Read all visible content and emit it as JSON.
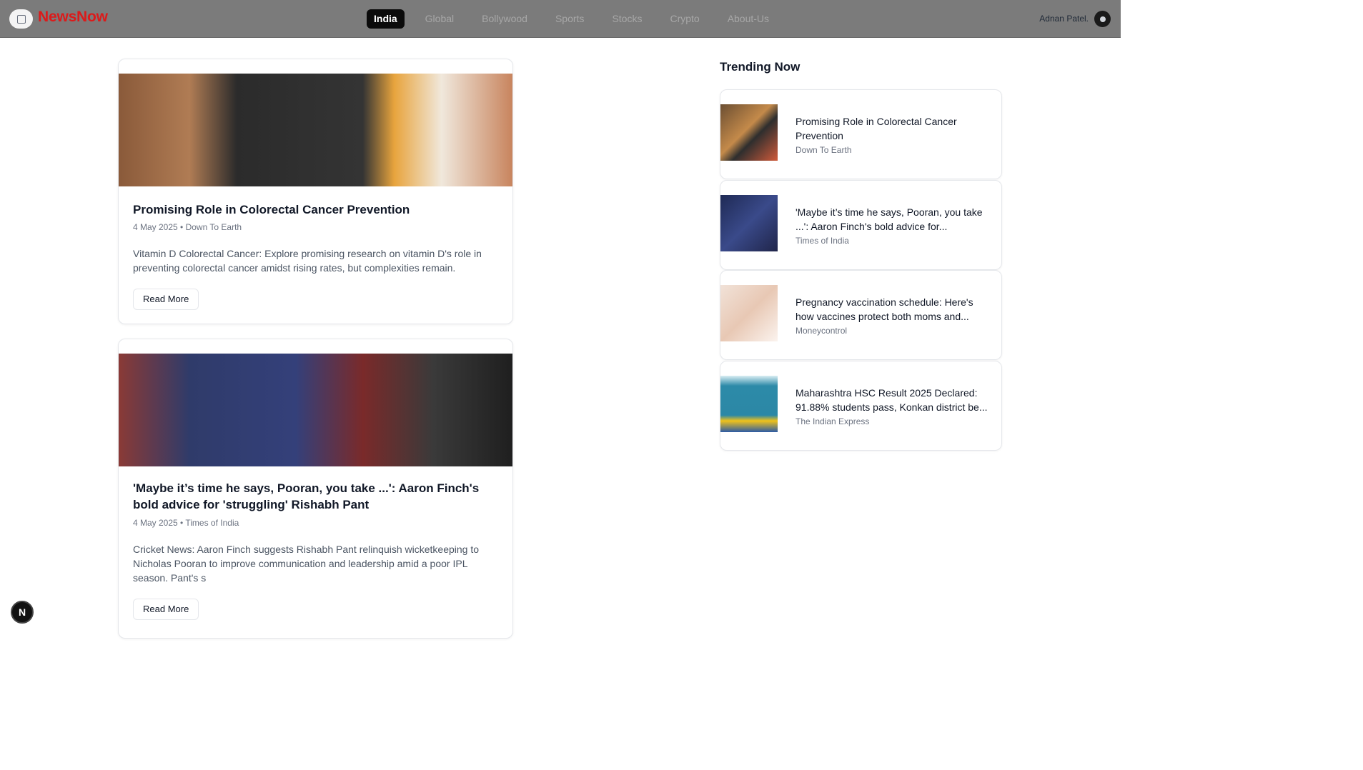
{
  "header": {
    "brand": "NewsNow",
    "nav": [
      "India",
      "Global",
      "Bollywood",
      "Sports",
      "Stocks",
      "Crypto",
      "About-Us"
    ],
    "active_nav": "India",
    "user_name": "Adnan Patel."
  },
  "articles": [
    {
      "title": "Promising Role in Colorectal Cancer Prevention",
      "date": "4 May 2025",
      "source": "Down To Earth",
      "description": "Vitamin D Colorectal Cancer: Explore promising research on vitamin D's role in preventing colorectal cancer amidst rising rates, but complexities remain.",
      "button": "Read More",
      "image_icon": "vitamin-d-image"
    },
    {
      "title": "'Maybe it’s time he says, Pooran, you take ...': Aaron Finch's bold advice for 'struggling' Rishabh Pant",
      "date": "4 May 2025",
      "source": "Times of India",
      "description": "Cricket News: Aaron Finch suggests Rishabh Pant relinquish wicketkeeping to Nicholas Pooran to improve communication and leadership amid a poor IPL season. Pant's s",
      "button": "Read More",
      "image_icon": "cricket-image"
    }
  ],
  "trending": {
    "title": "Trending Now",
    "items": [
      {
        "headline": "Promising Role in Colorectal Cancer Prevention",
        "source": "Down To Earth"
      },
      {
        "headline": "'Maybe it’s time he says, Pooran, you take ...': Aaron Finch's bold advice for...",
        "source": "Times of India"
      },
      {
        "headline": "Pregnancy vaccination schedule: Here's how vaccines protect both moms and...",
        "source": "Moneycontrol"
      },
      {
        "headline": "Maharashtra HSC Result 2025 Declared: 91.88% students pass, Konkan district be...",
        "source": "The Indian Express"
      }
    ]
  },
  "badge": "N",
  "colors": {
    "brand": "#dc1a1a",
    "header_bg": "#7b7b7b",
    "active_tab_bg": "#0b0b0b"
  }
}
